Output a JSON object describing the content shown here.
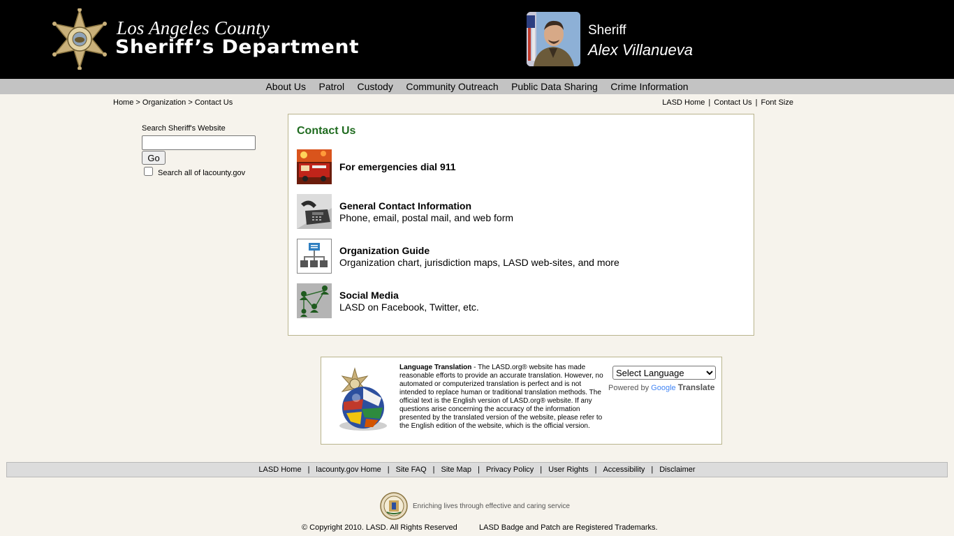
{
  "header": {
    "logo_line1": "Los Angeles County",
    "logo_line2": "Sheriff’s Department",
    "badge_text": "SHERIFF",
    "sheriff_title": "Sheriff",
    "sheriff_name": "Alex Villanueva"
  },
  "nav": {
    "items": [
      "About Us",
      "Patrol",
      "Custody",
      "Community Outreach",
      "Public Data Sharing",
      "Crime Information"
    ]
  },
  "breadcrumb": {
    "home": "Home",
    "sep": ">",
    "organization": "Organization",
    "current": "Contact Us"
  },
  "util_links": {
    "lasd_home": "LASD Home",
    "contact_us": "Contact Us",
    "font_size": "Font Size",
    "sep": "|"
  },
  "search": {
    "label": "Search Sheriff's Website",
    "value": "",
    "go_label": "Go",
    "checkbox_label": "Search all of lacounty.gov",
    "checked": false
  },
  "contact": {
    "title": "Contact Us",
    "items": [
      {
        "title": "For emergencies dial 911",
        "desc": ""
      },
      {
        "title": "General Contact Information",
        "desc": "Phone, email, postal mail, and web form"
      },
      {
        "title": "Organization Guide",
        "desc": "Organization chart, jurisdiction maps, LASD web-sites, and more"
      },
      {
        "title": "Social Media",
        "desc": "LASD on Facebook, Twitter, etc."
      }
    ]
  },
  "translation": {
    "heading": "Language Translation",
    "body": " - The LASD.org® website has made reasonable efforts to provide an accurate translation. However, no automated or computerized translation is perfect and is not intended to replace human or traditional translation methods. The official text is the English version of LASD.org® website. If any questions arise concerning the accuracy of the information presented by the translated version of the website, please refer to the English edition of the website, which is the official version.",
    "select_label": "Select Language",
    "powered_by": "Powered by",
    "google": "Google",
    "translate": "Translate"
  },
  "footer": {
    "links": [
      "LASD Home",
      "lacounty.gov Home",
      "Site FAQ",
      "Site Map",
      "Privacy Policy",
      "User Rights",
      "Accessibility",
      "Disclaimer"
    ],
    "sep": "|",
    "tagline": "Enriching lives through effective and caring service",
    "copyright": "© Copyright 2010. LASD. All Rights Reserved",
    "trademark": "LASD Badge and Patch are Registered Trademarks."
  },
  "colors": {
    "header_bg": "#000000",
    "nav_bg": "#c3c3c3",
    "page_bg": "#f6f3ec",
    "title_green": "#1f6b1f",
    "box_border": "#b9b48d"
  },
  "icons": [
    "sheriff-badge-icon",
    "fire-truck-icon",
    "telephone-icon",
    "org-chart-icon",
    "social-network-icon",
    "globe-flags-icon",
    "county-seal-icon"
  ]
}
